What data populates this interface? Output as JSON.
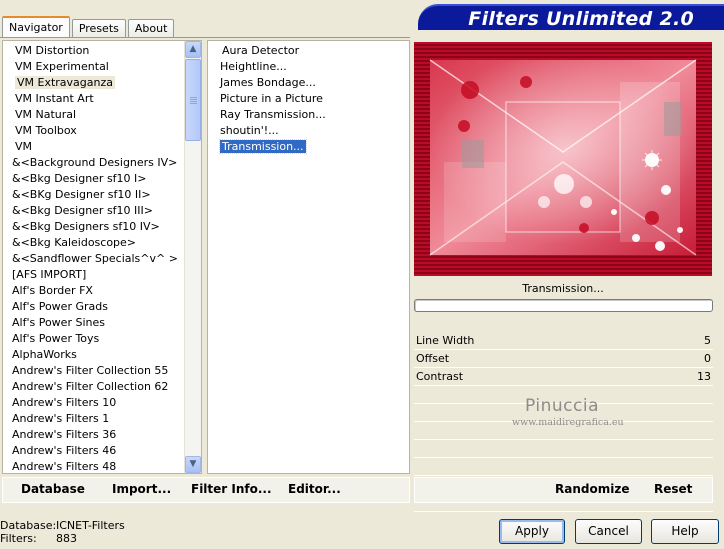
{
  "app": {
    "title": "Filters Unlimited 2.0"
  },
  "tabs": [
    {
      "label": "Navigator",
      "active": true
    },
    {
      "label": "Presets",
      "active": false
    },
    {
      "label": "About",
      "active": false
    }
  ],
  "categories": {
    "selected": "VM Extravaganza",
    "items": [
      "VM Distortion",
      "VM Experimental",
      "VM Extravaganza",
      "VM Instant Art",
      "VM Natural",
      "VM Toolbox",
      "VM",
      "&<Background Designers IV>",
      "&<Bkg Designer sf10 I>",
      "&<BKg Designer sf10 II>",
      "&<Bkg Designer sf10 III>",
      "&<Bkg Designers sf10 IV>",
      "&<Bkg Kaleidoscope>",
      "&<Sandflower Specials^v^ >",
      "[AFS IMPORT]",
      "Alf's Border FX",
      "Alf's Power Grads",
      "Alf's Power Sines",
      "Alf's Power Toys",
      "AlphaWorks",
      "Andrew's Filter Collection 55",
      "Andrew's Filter Collection 62",
      "Andrew's Filters 10",
      "Andrew's Filters 1",
      "Andrew's Filters 36",
      "Andrew's Filters 46",
      "Andrew's Filters 48"
    ]
  },
  "filters": {
    "selected": "Transmission...",
    "items": [
      "Aura Detector",
      "Heightline...",
      "James Bondage...",
      "Picture in a Picture",
      "Ray Transmission...",
      "shoutin'!...",
      "Transmission..."
    ]
  },
  "preview": {
    "caption": "Transmission...",
    "progress": 0,
    "accent_color": "#e0475c"
  },
  "params": [
    {
      "label": "Line Width",
      "value": "5"
    },
    {
      "label": "Offset",
      "value": "0"
    },
    {
      "label": "Contrast",
      "value": "13"
    }
  ],
  "watermark": {
    "name": "Pinuccia",
    "url": "www.maidiregrafica.eu"
  },
  "toolbar": {
    "database": "Database",
    "import": "Import...",
    "filter_info": "Filter Info...",
    "editor": "Editor...",
    "randomize": "Randomize",
    "reset": "Reset"
  },
  "status": {
    "database_label": "Database:",
    "database_value": "ICNET-Filters",
    "filters_label": "Filters:",
    "filters_value": "883"
  },
  "buttons": {
    "apply": "Apply",
    "cancel": "Cancel",
    "help": "Help"
  },
  "colors": {
    "banner": "#0a1a9a",
    "selection": "#316ac5",
    "frame": "#a00820"
  }
}
